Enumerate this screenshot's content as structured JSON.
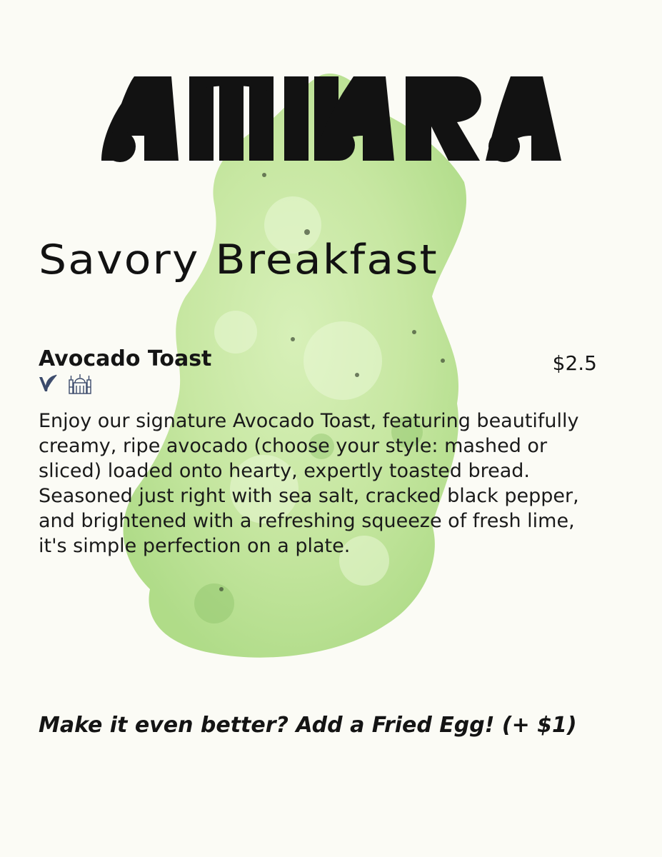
{
  "brand": {
    "logo_text": "AMARA"
  },
  "menu": {
    "section_title": "Savory Breakfast",
    "items": [
      {
        "name": "Avocado Toast",
        "price": "$2.5",
        "icons": [
          "vegan-leaf-icon",
          "halal-mosque-icon"
        ],
        "description": "Enjoy our signature Avocado Toast, featuring beautifully creamy, ripe avocado (choose your style: mashed or sliced) loaded onto hearty, expertly toasted bread. Seasoned just right with sea salt, cracked black pepper, and brightened with a refreshing squeeze of fresh lime, it's simple perfection on a plate."
      }
    ],
    "addon_note": "Make it even better? Add a Fried Egg! (+ $1)"
  },
  "colors": {
    "background": "#fbfbf5",
    "text": "#151515",
    "blob": "#c9e8a4",
    "icon": "#3b4a6b"
  }
}
